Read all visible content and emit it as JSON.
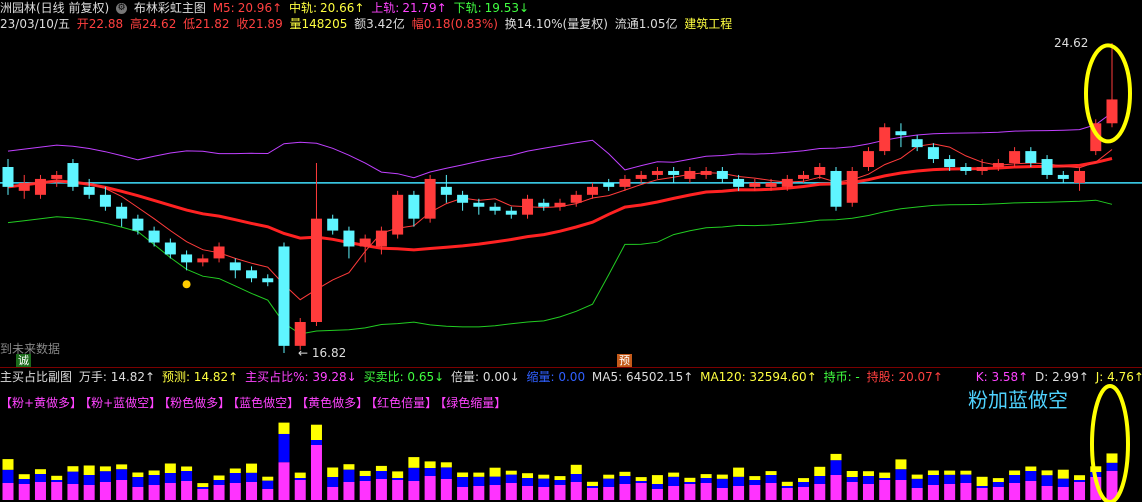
{
  "header1": {
    "title": "洲园林(日线 前复权)",
    "indicator_name": "布林彩虹主图",
    "m5_label": "M5:",
    "m5_value": "20.96↑",
    "mid_label": "中轨:",
    "mid_value": "20.66↑",
    "upper_label": "上轨:",
    "upper_value": "21.79↑",
    "lower_label": "下轨:",
    "lower_value": "19.53↓"
  },
  "header2": {
    "date": "23/03/10/五",
    "open": "开22.88",
    "high": "高24.62",
    "low": "低21.82",
    "close": "收21.89",
    "volume": "量148205",
    "amount": "额3.42亿",
    "range": "幅0.18(0.83%)",
    "turnover": "换14.10%(量复权)",
    "float": "流通1.05亿",
    "sector": "建筑工程"
  },
  "main_chart": {
    "high_label": "24.62",
    "low_label": "16.82",
    "nofuture": "到未来数据",
    "badge_left": "诚",
    "badge_mid": "预"
  },
  "panel": {
    "title": "主买占比副图",
    "wanshou": "万手: 14.82↑",
    "forecast": "预测: 14.82↑",
    "buy_ratio": "主买占比%: 39.28↓",
    "buy_sell": "买卖比: 0.65↓",
    "multiple": "倍量: 0.00↓",
    "shrink": "缩量: 0.00",
    "ma5": "MA5: 64502.15↑",
    "ma120": "MA120: 32594.60↑",
    "hold": "持币: -",
    "stock": "持股: 20.07↑",
    "k": "K: 3.58↑",
    "d": "D: 2.99↑",
    "j": "J: 4.76↑"
  },
  "chips": [
    "【粉+黄做多】",
    "【粉+蓝做空】",
    "【粉色做多】",
    "【蓝色做空】",
    "【黄色做多】",
    "【红色倍量】",
    "【绿色缩量】"
  ],
  "annotation": "粉加蓝做空",
  "colors": {
    "up": "#ff3b3b",
    "down": "#5ff5ff",
    "mid_line": "#ff2222",
    "upper_band": "#c040ff",
    "lower_band": "#22cc22",
    "yellow": "#ffff00",
    "cyan_hline": "#40e0ff",
    "pink": "#ff33ff",
    "blue": "#0000ff"
  },
  "chart_data": {
    "type": "candlestick",
    "price_range": [
      16.82,
      24.62
    ],
    "reference_line": 21.1,
    "candles": [
      {
        "o": 21.5,
        "c": 21.0,
        "h": 21.7,
        "l": 20.8
      },
      {
        "o": 20.9,
        "c": 21.1,
        "h": 21.3,
        "l": 20.7
      },
      {
        "o": 20.8,
        "c": 21.2,
        "h": 21.3,
        "l": 20.7
      },
      {
        "o": 21.2,
        "c": 21.3,
        "h": 21.4,
        "l": 21.0
      },
      {
        "o": 21.6,
        "c": 21.0,
        "h": 21.7,
        "l": 20.9
      },
      {
        "o": 21.0,
        "c": 20.8,
        "h": 21.2,
        "l": 20.7
      },
      {
        "o": 20.8,
        "c": 20.5,
        "h": 21.0,
        "l": 20.4
      },
      {
        "o": 20.5,
        "c": 20.2,
        "h": 20.6,
        "l": 20.0
      },
      {
        "o": 20.2,
        "c": 19.9,
        "h": 20.3,
        "l": 19.8
      },
      {
        "o": 19.9,
        "c": 19.6,
        "h": 20.0,
        "l": 19.5
      },
      {
        "o": 19.6,
        "c": 19.3,
        "h": 19.7,
        "l": 19.2
      },
      {
        "o": 19.3,
        "c": 19.1,
        "h": 19.4,
        "l": 18.9
      },
      {
        "o": 19.1,
        "c": 19.2,
        "h": 19.3,
        "l": 19.0
      },
      {
        "o": 19.2,
        "c": 19.5,
        "h": 19.6,
        "l": 19.1
      },
      {
        "o": 19.1,
        "c": 18.9,
        "h": 19.2,
        "l": 18.7
      },
      {
        "o": 18.9,
        "c": 18.7,
        "h": 19.0,
        "l": 18.6
      },
      {
        "o": 18.7,
        "c": 18.6,
        "h": 18.8,
        "l": 18.5
      },
      {
        "o": 19.5,
        "c": 17.0,
        "h": 19.6,
        "l": 16.82
      },
      {
        "o": 17.0,
        "c": 17.6,
        "h": 17.7,
        "l": 16.9
      },
      {
        "o": 17.6,
        "c": 20.2,
        "h": 21.6,
        "l": 17.5
      },
      {
        "o": 20.2,
        "c": 19.9,
        "h": 20.3,
        "l": 19.8
      },
      {
        "o": 19.9,
        "c": 19.5,
        "h": 20.0,
        "l": 19.2
      },
      {
        "o": 19.5,
        "c": 19.7,
        "h": 19.8,
        "l": 19.1
      },
      {
        "o": 19.5,
        "c": 19.9,
        "h": 20.0,
        "l": 19.3
      },
      {
        "o": 19.8,
        "c": 20.8,
        "h": 20.9,
        "l": 19.7
      },
      {
        "o": 20.8,
        "c": 20.2,
        "h": 20.9,
        "l": 20.0
      },
      {
        "o": 20.2,
        "c": 21.2,
        "h": 21.3,
        "l": 20.1
      },
      {
        "o": 21.0,
        "c": 20.8,
        "h": 21.3,
        "l": 20.6
      },
      {
        "o": 20.8,
        "c": 20.6,
        "h": 20.9,
        "l": 20.4
      },
      {
        "o": 20.6,
        "c": 20.5,
        "h": 20.7,
        "l": 20.3
      },
      {
        "o": 20.5,
        "c": 20.4,
        "h": 20.6,
        "l": 20.3
      },
      {
        "o": 20.4,
        "c": 20.3,
        "h": 20.5,
        "l": 20.2
      },
      {
        "o": 20.3,
        "c": 20.7,
        "h": 20.8,
        "l": 20.2
      },
      {
        "o": 20.6,
        "c": 20.5,
        "h": 20.7,
        "l": 20.4
      },
      {
        "o": 20.5,
        "c": 20.6,
        "h": 20.7,
        "l": 20.4
      },
      {
        "o": 20.6,
        "c": 20.8,
        "h": 20.9,
        "l": 20.5
      },
      {
        "o": 20.8,
        "c": 21.0,
        "h": 21.1,
        "l": 20.7
      },
      {
        "o": 21.1,
        "c": 21.0,
        "h": 21.2,
        "l": 20.9
      },
      {
        "o": 21.0,
        "c": 21.2,
        "h": 21.3,
        "l": 20.9
      },
      {
        "o": 21.2,
        "c": 21.3,
        "h": 21.4,
        "l": 21.1
      },
      {
        "o": 21.3,
        "c": 21.4,
        "h": 21.5,
        "l": 21.2
      },
      {
        "o": 21.4,
        "c": 21.3,
        "h": 21.5,
        "l": 21.1
      },
      {
        "o": 21.2,
        "c": 21.4,
        "h": 21.5,
        "l": 21.1
      },
      {
        "o": 21.3,
        "c": 21.4,
        "h": 21.5,
        "l": 21.2
      },
      {
        "o": 21.4,
        "c": 21.2,
        "h": 21.5,
        "l": 21.1
      },
      {
        "o": 21.2,
        "c": 21.0,
        "h": 21.3,
        "l": 20.9
      },
      {
        "o": 21.0,
        "c": 21.1,
        "h": 21.2,
        "l": 20.9
      },
      {
        "o": 21.0,
        "c": 21.1,
        "h": 21.2,
        "l": 20.9
      },
      {
        "o": 21.0,
        "c": 21.2,
        "h": 21.3,
        "l": 20.9
      },
      {
        "o": 21.2,
        "c": 21.3,
        "h": 21.4,
        "l": 21.1
      },
      {
        "o": 21.3,
        "c": 21.5,
        "h": 21.6,
        "l": 21.2
      },
      {
        "o": 21.4,
        "c": 20.5,
        "h": 21.5,
        "l": 20.4
      },
      {
        "o": 20.6,
        "c": 21.4,
        "h": 21.5,
        "l": 20.5
      },
      {
        "o": 21.5,
        "c": 21.9,
        "h": 22.0,
        "l": 21.4
      },
      {
        "o": 21.9,
        "c": 22.5,
        "h": 22.6,
        "l": 21.8
      },
      {
        "o": 22.4,
        "c": 22.3,
        "h": 22.6,
        "l": 22.0
      },
      {
        "o": 22.2,
        "c": 22.0,
        "h": 22.3,
        "l": 21.9
      },
      {
        "o": 22.0,
        "c": 21.7,
        "h": 22.1,
        "l": 21.6
      },
      {
        "o": 21.7,
        "c": 21.5,
        "h": 21.8,
        "l": 21.4
      },
      {
        "o": 21.5,
        "c": 21.4,
        "h": 21.6,
        "l": 21.3
      },
      {
        "o": 21.4,
        "c": 21.5,
        "h": 21.7,
        "l": 21.3
      },
      {
        "o": 21.5,
        "c": 21.6,
        "h": 21.7,
        "l": 21.4
      },
      {
        "o": 21.6,
        "c": 21.9,
        "h": 22.0,
        "l": 21.5
      },
      {
        "o": 21.9,
        "c": 21.6,
        "h": 22.0,
        "l": 21.5
      },
      {
        "o": 21.7,
        "c": 21.3,
        "h": 21.8,
        "l": 21.2
      },
      {
        "o": 21.3,
        "c": 21.2,
        "h": 21.4,
        "l": 21.1
      },
      {
        "o": 21.1,
        "c": 21.4,
        "h": 21.5,
        "l": 20.9
      },
      {
        "o": 21.9,
        "c": 22.6,
        "h": 22.7,
        "l": 21.8
      },
      {
        "o": 22.6,
        "c": 23.2,
        "h": 24.62,
        "l": 22.5
      }
    ]
  }
}
